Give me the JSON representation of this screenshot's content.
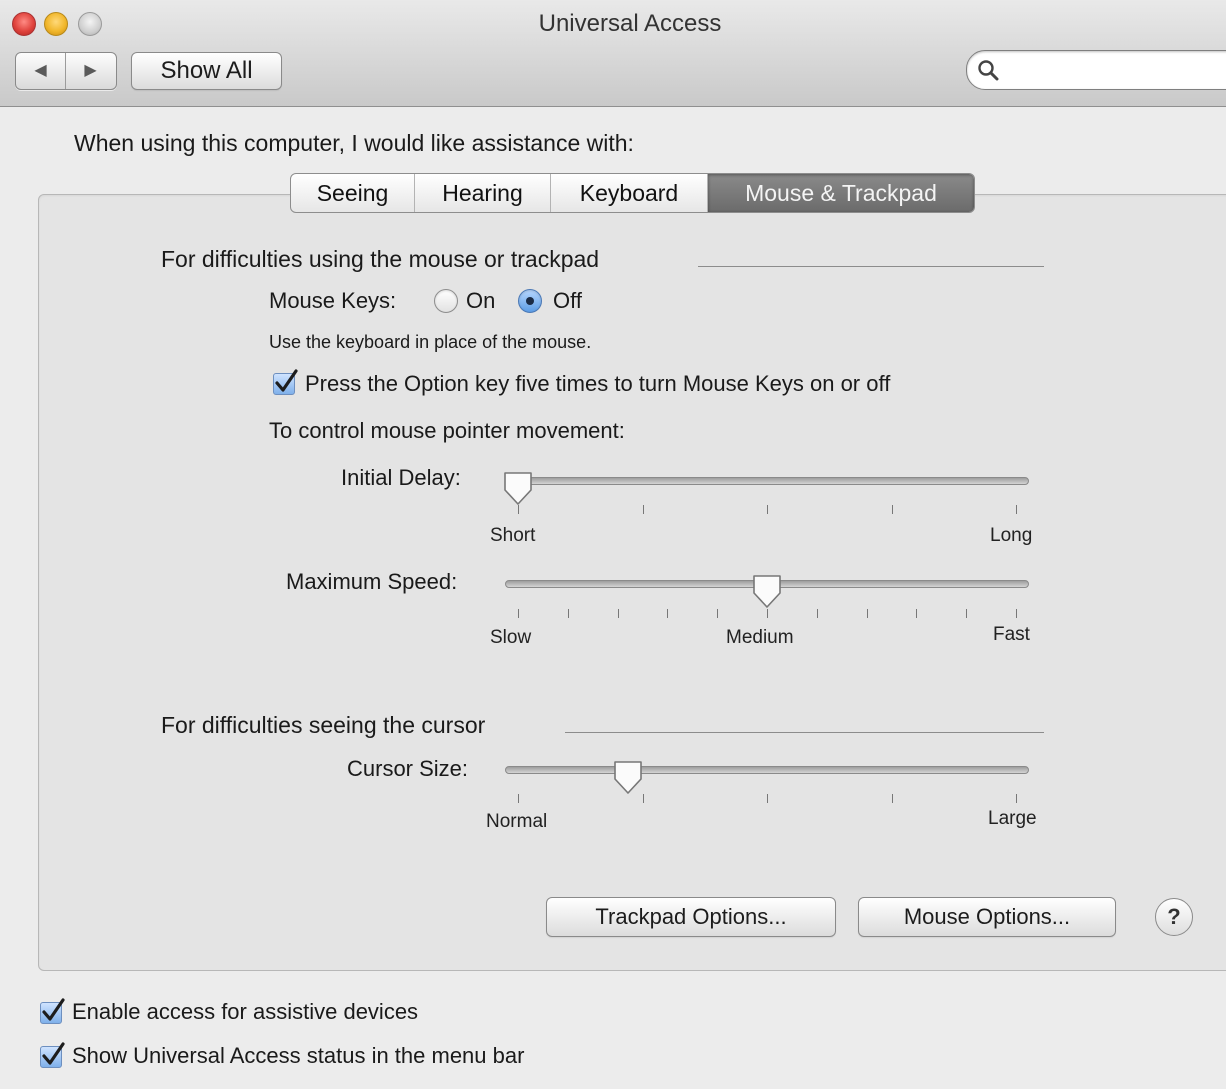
{
  "window": {
    "title": "Universal Access",
    "nav_back": "◀",
    "nav_forward": "▶",
    "show_all_label": "Show All",
    "search_value": ""
  },
  "intro_text": "When using this computer, I would like assistance with:",
  "tabs": [
    {
      "label": "Seeing",
      "selected": false
    },
    {
      "label": "Hearing",
      "selected": false
    },
    {
      "label": "Keyboard",
      "selected": false
    },
    {
      "label": "Mouse & Trackpad",
      "selected": true
    }
  ],
  "mouse_section": {
    "heading": "For difficulties using the mouse or trackpad",
    "mouse_keys_label": "Mouse Keys:",
    "mouse_keys_on_label": "On",
    "mouse_keys_off_label": "Off",
    "mouse_keys_value": "Off",
    "hint": "Use the keyboard in place of the mouse.",
    "option_key_label": "Press the Option key five times to turn Mouse Keys on or off",
    "option_key_checked": true,
    "pointer_heading": "To control mouse pointer movement:",
    "initial_delay": {
      "label": "Initial Delay:",
      "min_label": "Short",
      "max_label": "Long",
      "position": 0.0,
      "tick_count": 5
    },
    "maximum_speed": {
      "label": "Maximum Speed:",
      "min_label": "Slow",
      "mid_label": "Medium",
      "max_label": "Fast",
      "position": 0.5,
      "tick_count": 11
    }
  },
  "cursor_section": {
    "heading": "For difficulties seeing the cursor",
    "cursor_size": {
      "label": "Cursor Size:",
      "min_label": "Normal",
      "max_label": "Large",
      "position": 0.22,
      "tick_count": 5
    }
  },
  "buttons": {
    "trackpad_options": "Trackpad Options...",
    "mouse_options": "Mouse Options...",
    "help": "?"
  },
  "footer": {
    "assistive_devices_label": "Enable access for assistive devices",
    "assistive_devices_checked": true,
    "status_menu_label": "Show Universal Access status in the menu bar",
    "status_menu_checked": true
  }
}
